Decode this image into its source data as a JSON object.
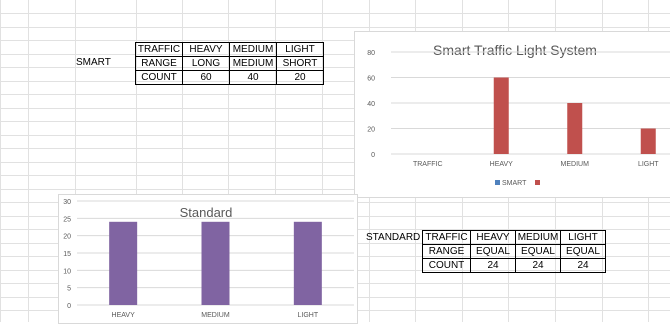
{
  "sheet": {
    "smart_label": "SMART",
    "standard_label": "STANDARD"
  },
  "smart_table": {
    "rows": [
      [
        "TRAFFIC",
        "HEAVY",
        "MEDIUM",
        "LIGHT"
      ],
      [
        "RANGE",
        "LONG",
        "MEDIUM",
        "SHORT"
      ],
      [
        "COUNT",
        "60",
        "40",
        "20"
      ]
    ]
  },
  "standard_table": {
    "rows": [
      [
        "TRAFFIC",
        "HEAVY",
        "MEDIUM",
        "LIGHT"
      ],
      [
        "RANGE",
        "EQUAL",
        "EQUAL",
        "EQUAL"
      ],
      [
        "COUNT",
        "24",
        "24",
        "24"
      ]
    ]
  },
  "colors": {
    "smart_series": "#c0504d",
    "smart_legend_marker": "#4f81bd",
    "standard_series": "#8064a2",
    "gridline": "#d9d9d9",
    "axis_text": "#595959"
  },
  "chart_data": [
    {
      "type": "bar",
      "title": "Smart Traffic Light System",
      "categories": [
        "TRAFFIC",
        "HEAVY",
        "MEDIUM",
        "LIGHT"
      ],
      "series": [
        {
          "name": "SMART",
          "values": [
            0,
            60,
            40,
            20
          ]
        }
      ],
      "legend_labels": [
        "SMART",
        ""
      ],
      "y_ticks": [
        0,
        20,
        40,
        60,
        80
      ],
      "ylim": [
        0,
        80
      ],
      "grid": true,
      "legend": "bottom"
    },
    {
      "type": "bar",
      "title": "Standard",
      "categories": [
        "HEAVY",
        "MEDIUM",
        "LIGHT"
      ],
      "series": [
        {
          "values": [
            24,
            24,
            24
          ]
        }
      ],
      "y_ticks": [
        0,
        5,
        10,
        15,
        20,
        25,
        30
      ],
      "ylim": [
        0,
        30
      ],
      "grid": true,
      "legend": "none"
    }
  ]
}
